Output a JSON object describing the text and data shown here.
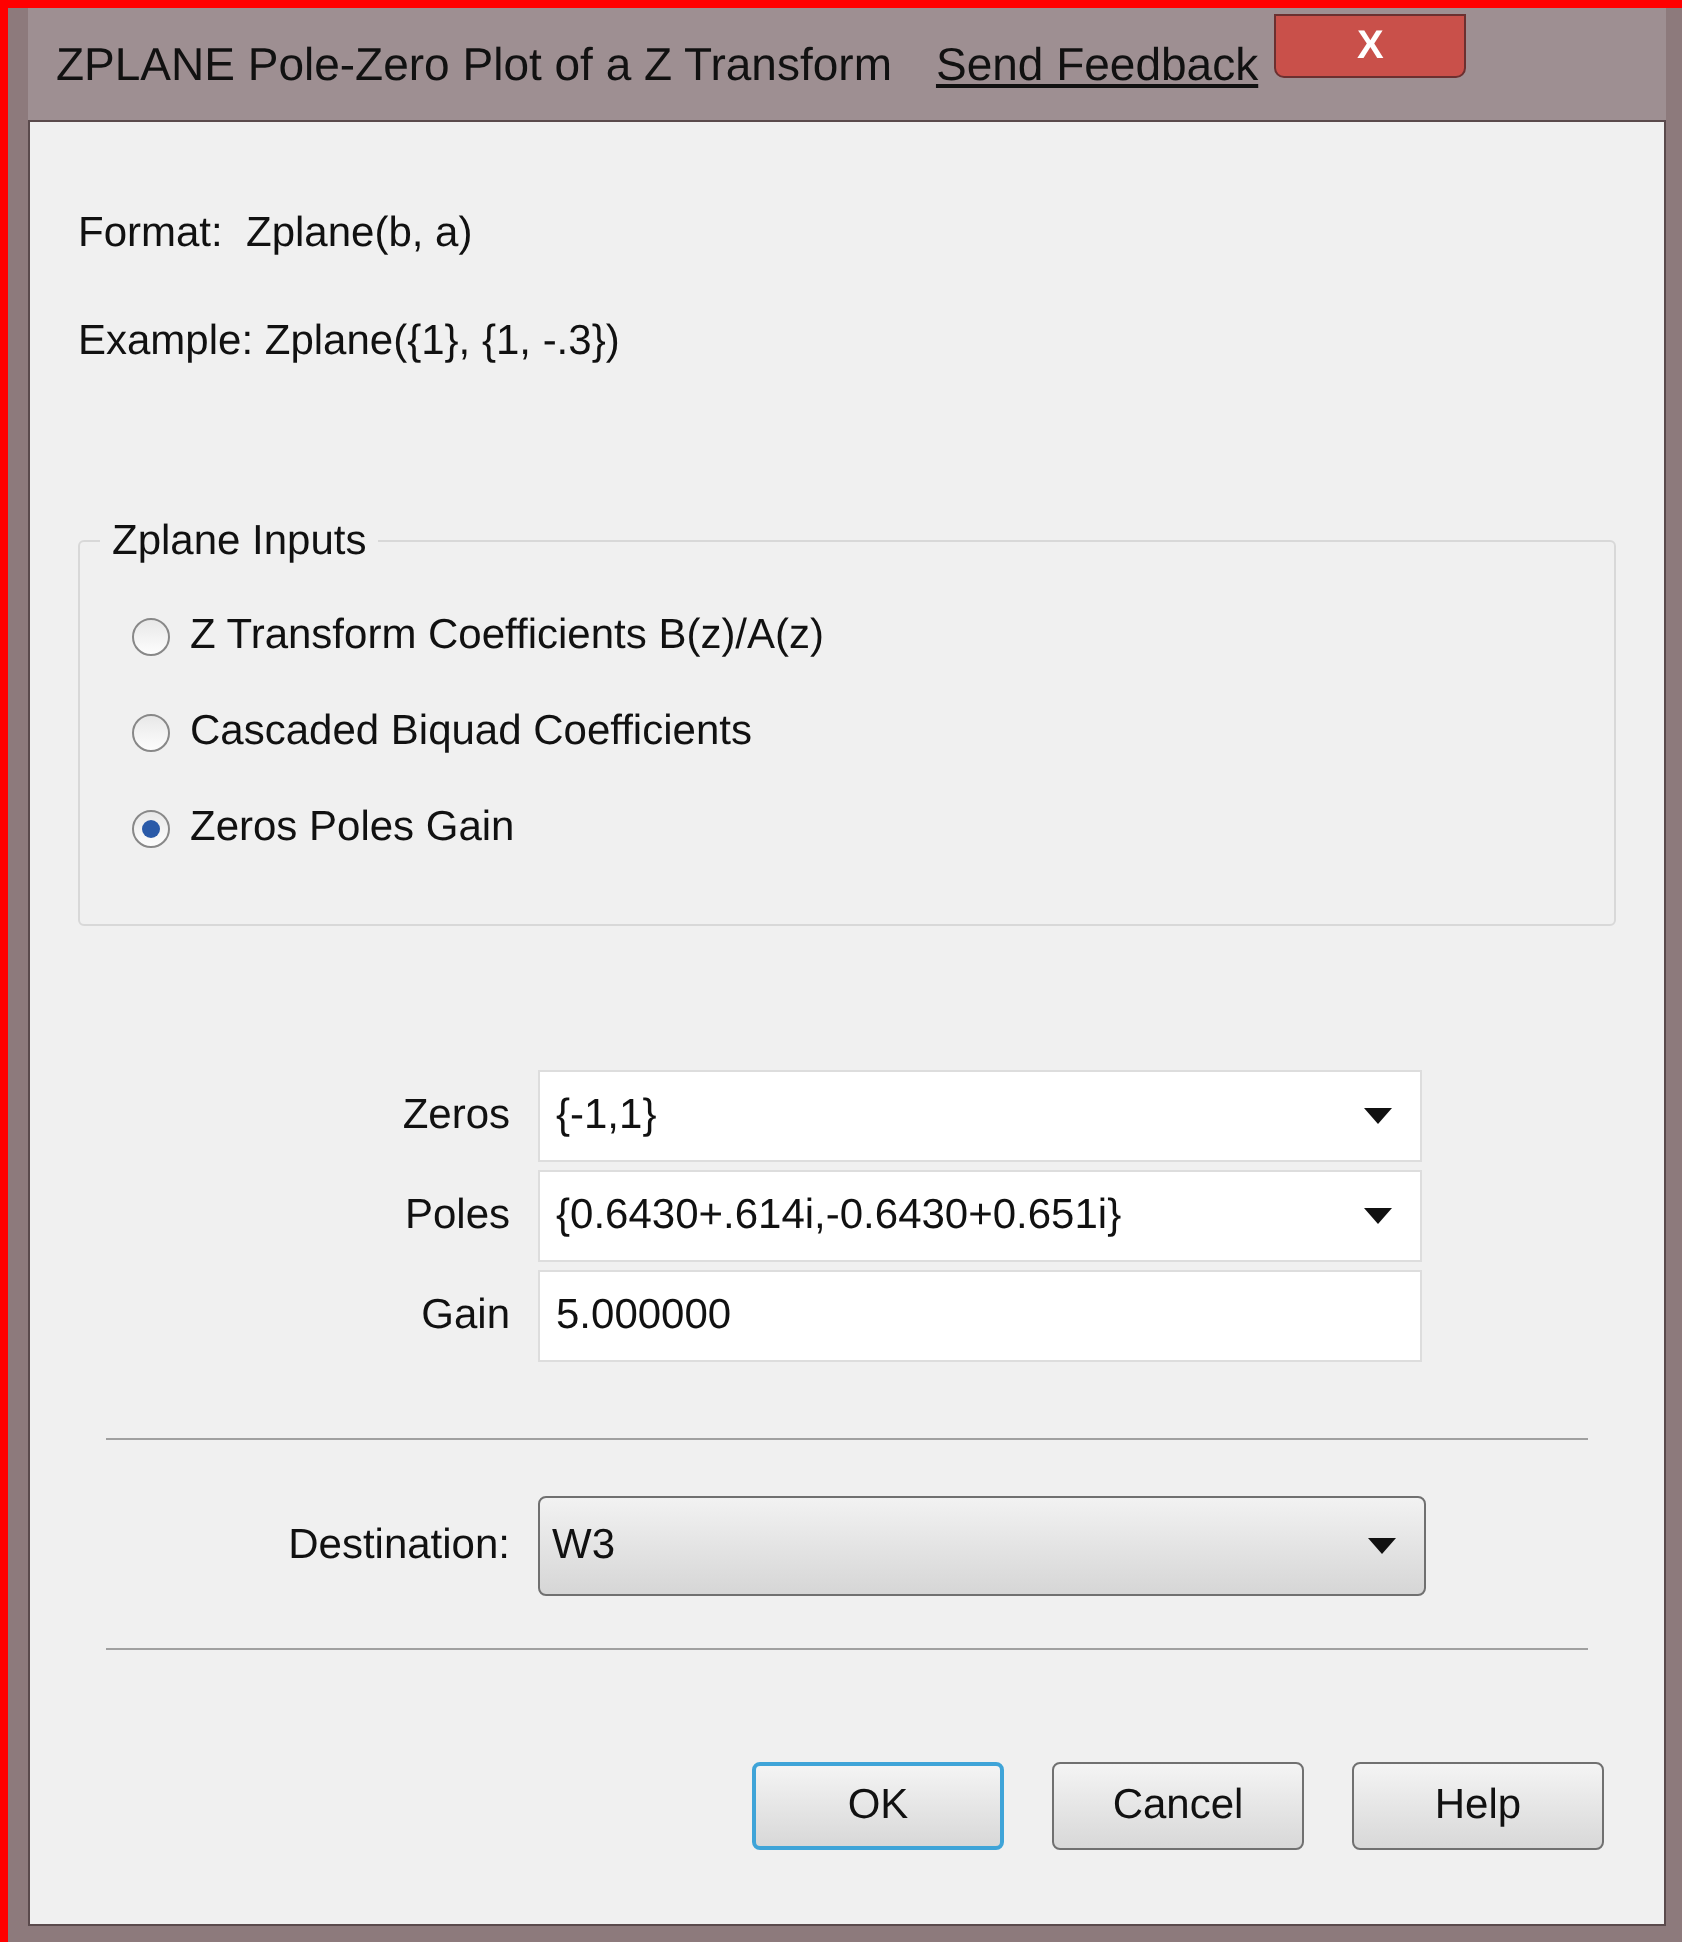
{
  "window": {
    "title": "ZPLANE Pole-Zero Plot of a Z Transform",
    "link": "Send Feedback",
    "close": "X"
  },
  "info": [
    "Format:  Zplane(b, a)",
    "Example: Zplane({1}, {1, -.3})"
  ],
  "inputs_group": {
    "title": "Zplane Inputs",
    "options": [
      {
        "label": "Z Transform Coefficients B(z)/A(z)",
        "selected": false
      },
      {
        "label": "Cascaded Biquad Coefficients",
        "selected": false
      },
      {
        "label": "Zeros Poles Gain",
        "selected": true
      }
    ]
  },
  "fields": [
    {
      "label": "Zeros",
      "value": "{-1,1}",
      "kind": "combo"
    },
    {
      "label": "Poles",
      "value": "{0.6430+.614i,-0.6430+0.651i}",
      "kind": "combo"
    },
    {
      "label": "Gain",
      "value": "5.000000",
      "kind": "text"
    }
  ],
  "destination": {
    "label": "Destination:",
    "value": "W3"
  },
  "buttons": [
    {
      "label": "OK",
      "default": true
    },
    {
      "label": "Cancel",
      "default": false
    },
    {
      "label": "Help",
      "default": false
    }
  ]
}
